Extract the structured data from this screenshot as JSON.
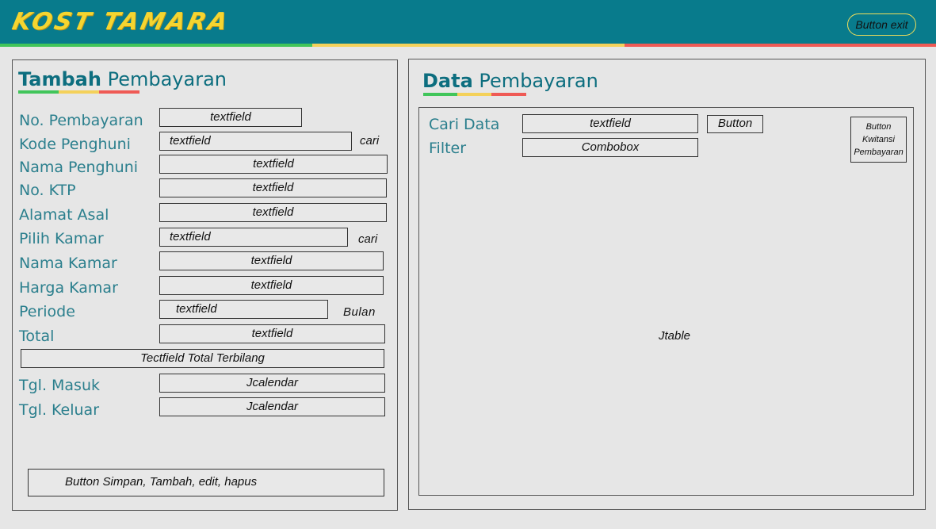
{
  "header": {
    "app_title": "KOST TAMARA",
    "exit_button": "Button exit",
    "colors": {
      "bar": "#087b8c",
      "logo": "#f5d530",
      "stripe_green": "#41c55a",
      "stripe_yellow": "#f4d15a",
      "stripe_red": "#ef5a55"
    }
  },
  "left_panel": {
    "title_bold": "Tambah",
    "title_rest": " Pembayaran",
    "fields": {
      "no_pembayaran": {
        "label": "No. Pembayaran",
        "value": "textfield"
      },
      "kode_penghuni": {
        "label": "Kode Penghuni",
        "value": "textfield",
        "side": "cari"
      },
      "nama_penghuni": {
        "label": "Nama Penghuni",
        "value": "textfield"
      },
      "no_ktp": {
        "label": "No. KTP",
        "value": "textfield"
      },
      "alamat_asal": {
        "label": "Alamat Asal",
        "value": "textfield"
      },
      "pilih_kamar": {
        "label": "Pilih Kamar",
        "value": "textfield",
        "side": "cari"
      },
      "nama_kamar": {
        "label": "Nama  Kamar",
        "value": "textfield"
      },
      "harga_kamar": {
        "label": "Harga Kamar",
        "value": "textfield"
      },
      "periode": {
        "label": "Periode",
        "value": "textfield",
        "side": "Bulan"
      },
      "total": {
        "label": "Total",
        "value": "textfield"
      },
      "total_terbilang": {
        "value": "Tectfield Total Terbilang"
      },
      "tgl_masuk": {
        "label": "Tgl. Masuk",
        "value": "Jcalendar"
      },
      "tgl_keluar": {
        "label": "Tgl. Keluar",
        "value": "Jcalendar"
      }
    },
    "action_buttons": "Button Simpan, Tambah, edit, hapus"
  },
  "right_panel": {
    "title_bold": "Data",
    "title_rest": " Pembayaran",
    "search_label": "Cari Data",
    "search_value": "textfield",
    "search_button": "Button",
    "filter_label": "Filter",
    "filter_value": "Combobox",
    "kwitansi_button": [
      "Button",
      "Kwitansi",
      "Pembayaran"
    ],
    "table": "Jtable"
  }
}
